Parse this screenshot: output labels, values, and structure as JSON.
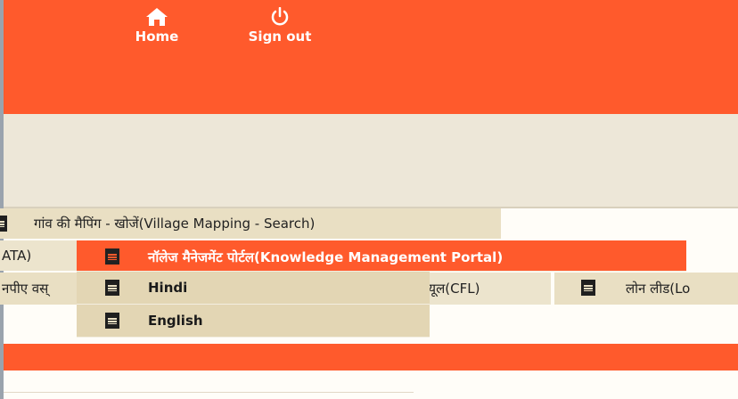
{
  "header": {
    "home_label": "Home",
    "signout_label": "Sign out"
  },
  "menu": {
    "village_mapping": "गांव की मैपिंग - खोजें(Village Mapping - Search)",
    "data_partial": "ATA)",
    "misc_partial": "नपीए वस्",
    "cfl_partial": "न्यूल(CFL)",
    "loan_partial": "लोन लीड(Lo"
  },
  "submenu": {
    "items": [
      {
        "label": "नॉलेज मैनेजमेंट पोर्टल(Knowledge Management Portal)"
      },
      {
        "label": "Hindi"
      },
      {
        "label": "English"
      }
    ]
  },
  "colors": {
    "brand_orange": "#ff5a2c",
    "menu_beige": "#e3d6b4",
    "band_beige": "#ede7d8"
  }
}
